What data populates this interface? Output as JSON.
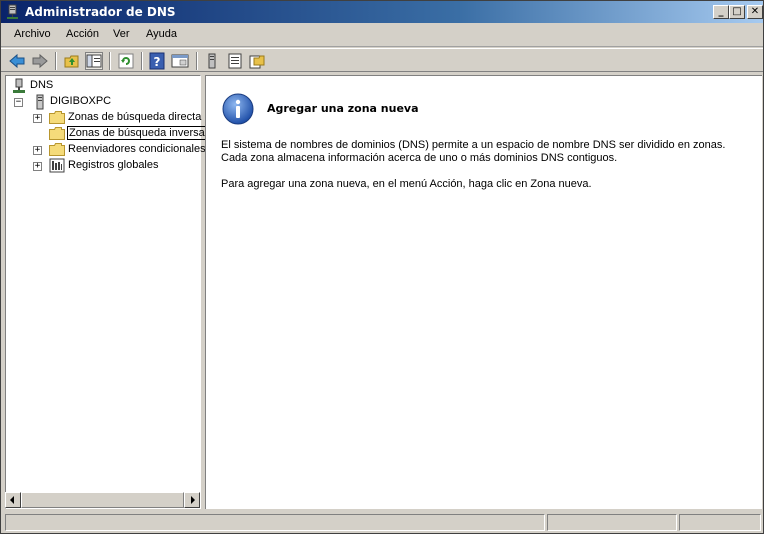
{
  "window": {
    "title": "Administrador de DNS"
  },
  "titlebar_buttons": {
    "minimize": "_",
    "maximize": "□",
    "close": "✕"
  },
  "menu": [
    "Archivo",
    "Acción",
    "Ver",
    "Ayuda"
  ],
  "toolbar": {
    "icons": [
      "back-arrow-icon",
      "forward-arrow-icon",
      "up-folder-icon",
      "show-hide-tree-icon",
      "refresh-icon",
      "help-icon",
      "properties-icon",
      "server-icon",
      "list-icon",
      "new-zone-icon"
    ]
  },
  "tree": {
    "root": "DNS",
    "server": "DIGIBOXPC",
    "children": [
      {
        "label": "Zonas de búsqueda directa",
        "expandable": true
      },
      {
        "label": "Zonas de búsqueda inversa",
        "expandable": false,
        "selected": true
      },
      {
        "label": "Reenviadores condicionales",
        "expandable": true
      },
      {
        "label": "Registros globales",
        "expandable": true
      }
    ],
    "expander_plus": "+",
    "expander_minus": "−"
  },
  "content": {
    "heading": "Agregar una zona nueva",
    "paragraph1_line1": "El sistema de nombres de dominios (DNS) permite a un espacio de nombre DNS ser dividido en zonas.",
    "paragraph1_line2": "Cada zona almacena información acerca de uno o más dominios DNS contiguos.",
    "paragraph2": "Para agregar una zona nueva, en el menú Acción, haga clic en Zona nueva."
  },
  "colors": {
    "titlebar_start": "#0a246a",
    "titlebar_end": "#a6caf0",
    "info_blue": "#2b5fb3"
  }
}
